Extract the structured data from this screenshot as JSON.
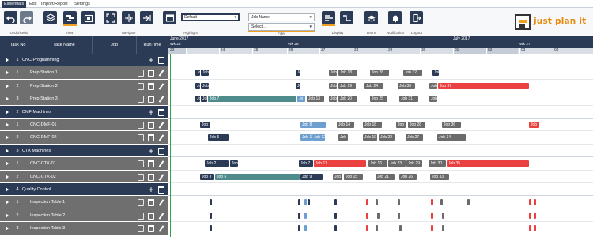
{
  "menu": {
    "tabs": [
      "Essentials",
      "Edit",
      "Import/Report",
      "Settings"
    ]
  },
  "ribbon": {
    "groups": {
      "undo_redo": "Undo/Redo",
      "view": "View",
      "navigate": "Navigate",
      "highlight": "Highlight",
      "filter": "Filter",
      "display": "Display",
      "learn": "Learn",
      "notification": "Notification",
      "logout": "Logout"
    },
    "highlight_value": "Default",
    "filter_field": "Job Name",
    "filter_value": "Select..."
  },
  "brand": {
    "logo_text": "just plan it",
    "accent": "#e8890c",
    "navy": "#2b3a55"
  },
  "grid": {
    "headers": {
      "task_no": "Task No",
      "task_name": "Task Name",
      "job": "Job",
      "runtime": "RunTime"
    }
  },
  "timeline": {
    "months": [
      {
        "label": "June 2017"
      },
      {
        "label": "July 2017"
      }
    ],
    "weeks": [
      {
        "label": "Wk 25"
      },
      {
        "label": "Wk 26"
      },
      {
        "label": "Wk 27"
      }
    ],
    "days": [
      {
        "label": "23"
      },
      {
        "label": "24"
      },
      {
        "label": "25"
      },
      {
        "label": "26"
      },
      {
        "label": "27"
      },
      {
        "label": "28"
      },
      {
        "label": "29"
      },
      {
        "label": "30"
      },
      {
        "label": "01"
      },
      {
        "label": "02"
      },
      {
        "label": "03"
      },
      {
        "label": "04"
      }
    ]
  },
  "rows": [
    {
      "type": "group",
      "no": "1",
      "name": "CNC Programming"
    },
    {
      "type": "item",
      "no": "1",
      "name": "Prep Station 1"
    },
    {
      "type": "item",
      "no": "2",
      "name": "Prep Station 2"
    },
    {
      "type": "item",
      "no": "3",
      "name": "Prep Station 3"
    },
    {
      "type": "group",
      "no": "2",
      "name": "DMF Machines"
    },
    {
      "type": "item",
      "no": "1",
      "name": "CNC-DMF-01"
    },
    {
      "type": "item",
      "no": "2",
      "name": "CNC-DMF-02"
    },
    {
      "type": "group",
      "no": "3",
      "name": "CTX Machines"
    },
    {
      "type": "item",
      "no": "1",
      "name": "CNC-CTX-01"
    },
    {
      "type": "item",
      "no": "2",
      "name": "CNC-CTX-02"
    },
    {
      "type": "group",
      "no": "4",
      "name": "Quality Control"
    },
    {
      "type": "item",
      "no": "1",
      "name": "Inspection Table 1"
    },
    {
      "type": "item",
      "no": "2",
      "name": "Inspection Table 2"
    },
    {
      "type": "item",
      "no": "3",
      "name": "Inspection Table 3"
    }
  ],
  "jobs": {
    "r1": [
      {
        "label": "Jo",
        "c": "navy"
      },
      {
        "label": "Job",
        "c": "navy"
      },
      {
        "label": "Jo",
        "c": "navy"
      },
      {
        "label": "Job",
        "c": "grey"
      },
      {
        "label": "Job 18",
        "c": "grey"
      },
      {
        "label": "Job 26",
        "c": "grey"
      },
      {
        "label": "Job 32",
        "c": "grey"
      },
      {
        "label": "Job",
        "c": "navy"
      }
    ],
    "r2": [
      {
        "label": "Jo",
        "c": "navy"
      },
      {
        "label": "Job",
        "c": "navy"
      },
      {
        "label": "Jo",
        "c": "navy"
      },
      {
        "label": "Job",
        "c": "grey"
      },
      {
        "label": "Job 19",
        "c": "grey"
      },
      {
        "label": "Job 24",
        "c": "grey"
      },
      {
        "label": "Job 30",
        "c": "grey"
      },
      {
        "label": "Job",
        "c": "grey"
      },
      {
        "label": "Job 37",
        "c": "red"
      }
    ],
    "r3": [
      {
        "label": "Jo",
        "c": "navy"
      },
      {
        "label": "Job",
        "c": "navy"
      },
      {
        "label": "Job 7",
        "c": "teal"
      },
      {
        "label": "Jo",
        "c": "lightblue"
      },
      {
        "label": "Job 13",
        "c": "grey"
      },
      {
        "label": "Job",
        "c": "grey"
      },
      {
        "label": "Job 20",
        "c": "grey"
      },
      {
        "label": "Job 25",
        "c": "grey"
      },
      {
        "label": "Job 31",
        "c": "grey"
      },
      {
        "label": "Job",
        "c": "grey"
      }
    ],
    "r5": [
      {
        "label": "Job 1",
        "c": "navy"
      },
      {
        "label": "Job 8",
        "c": "lightblue"
      },
      {
        "label": "Job 14",
        "c": "grey"
      },
      {
        "label": "Job 18",
        "c": "grey"
      },
      {
        "label": "Job",
        "c": "grey"
      },
      {
        "label": "Job 28",
        "c": "grey"
      },
      {
        "label": "Job 36",
        "c": "grey"
      },
      {
        "label": "Job",
        "c": "red"
      }
    ],
    "r6": [
      {
        "label": "Job 5",
        "c": "navy"
      },
      {
        "label": "Job 1",
        "c": "lightblue"
      },
      {
        "label": "Job 12",
        "c": "lightblue"
      },
      {
        "label": "Job",
        "c": "grey"
      },
      {
        "label": "Job 19",
        "c": "grey"
      },
      {
        "label": "Job 22",
        "c": "grey"
      },
      {
        "label": "Job 27",
        "c": "grey"
      },
      {
        "label": "Job 34",
        "c": "grey"
      }
    ],
    "r8": [
      {
        "label": "Job 2",
        "c": "navy"
      },
      {
        "label": "Job",
        "c": "navy"
      },
      {
        "label": "Job 7",
        "c": "navy"
      },
      {
        "label": "Job 11",
        "c": "red"
      },
      {
        "label": "Job 16",
        "c": "grey"
      },
      {
        "label": "Job 23",
        "c": "grey"
      },
      {
        "label": "Job 29",
        "c": "grey"
      },
      {
        "label": "Job 30",
        "c": "grey"
      },
      {
        "label": "Job 35",
        "c": "red"
      }
    ],
    "r9": [
      {
        "label": "Job 3",
        "c": "navy"
      },
      {
        "label": "Job 6",
        "c": "teal"
      },
      {
        "label": "Job 9",
        "c": "navy"
      },
      {
        "label": "Job",
        "c": "grey"
      },
      {
        "label": "Job 15",
        "c": "grey"
      },
      {
        "label": "Job 21",
        "c": "grey"
      },
      {
        "label": "Job 26",
        "c": "grey"
      },
      {
        "label": "Job 33",
        "c": "grey"
      }
    ]
  }
}
